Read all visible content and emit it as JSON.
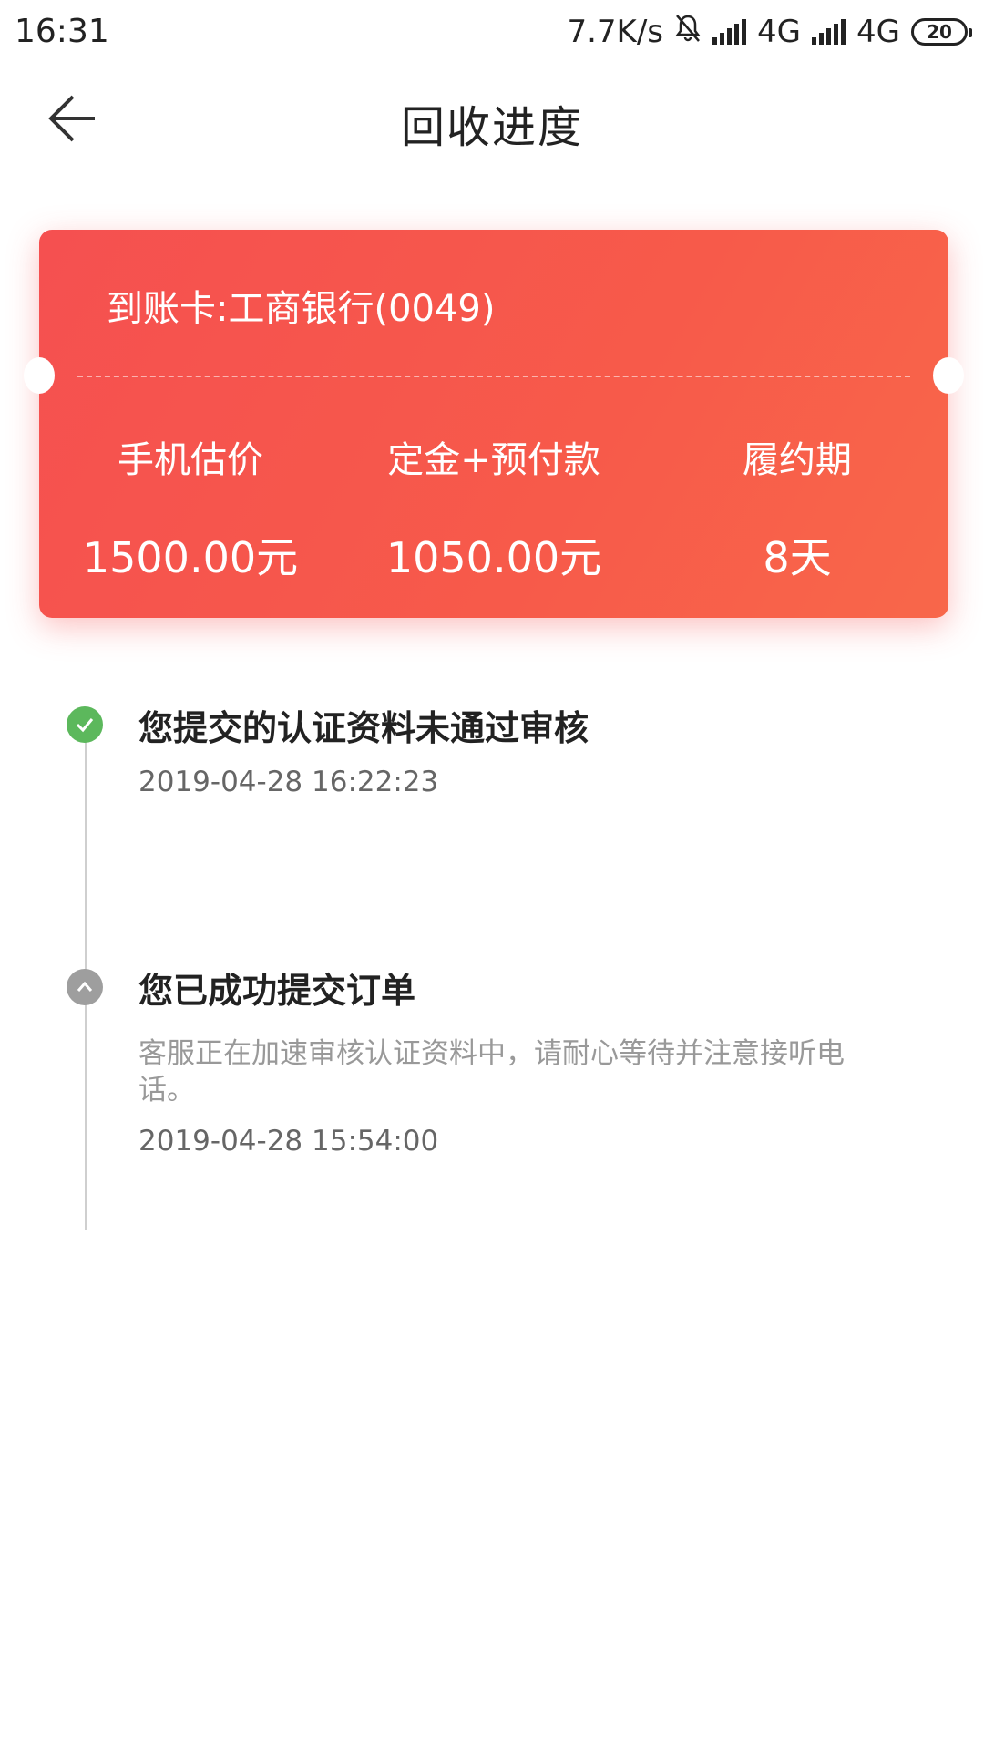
{
  "status_bar": {
    "time": "16:31",
    "net_speed": "7.7K/s",
    "network1": "4G",
    "network2": "4G",
    "battery": "20"
  },
  "header": {
    "title": "回收进度",
    "back_icon": "arrow-left-icon"
  },
  "card": {
    "bank": "到账卡:工商银行(0049)",
    "columns": [
      {
        "label": "手机估价",
        "value": "1500.00元"
      },
      {
        "label": "定金+预付款",
        "value": "1050.00元"
      },
      {
        "label": "履约期",
        "value": "8天"
      }
    ],
    "colors": {
      "start": "#f55050",
      "end": "#f8674a"
    }
  },
  "timeline": [
    {
      "title": "您提交的认证资料未通过审核",
      "time": "2019-04-28 16:22:23",
      "icon": "check-icon",
      "color": "#5cb85c"
    },
    {
      "title": "您已成功提交订单",
      "desc": "客服正在加速审核认证资料中，请耐心等待并注意接听电话。",
      "time": "2019-04-28 15:54:00",
      "icon": "chevron-up-icon",
      "color": "#9e9e9e"
    }
  ]
}
